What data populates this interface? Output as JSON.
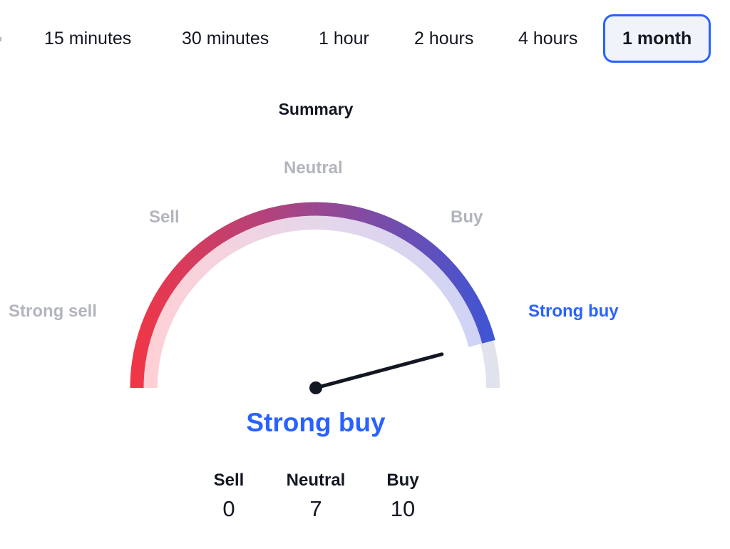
{
  "tabs": [
    {
      "label": "15 minutes",
      "active": false
    },
    {
      "label": "30 minutes",
      "active": false
    },
    {
      "label": "1 hour",
      "active": false
    },
    {
      "label": "2 hours",
      "active": false
    },
    {
      "label": "4 hours",
      "active": false
    },
    {
      "label": "1 month",
      "active": true
    }
  ],
  "summary": {
    "title": "Summary",
    "gauge_labels": {
      "strong_sell": "Strong sell",
      "sell": "Sell",
      "neutral": "Neutral",
      "buy": "Buy",
      "strong_buy": "Strong buy"
    },
    "active_label": "strong_buy",
    "gauge_value": 0.917,
    "result": "Strong buy",
    "counts": [
      {
        "label": "Sell",
        "value": "0"
      },
      {
        "label": "Neutral",
        "value": "7"
      },
      {
        "label": "Buy",
        "value": "10"
      }
    ]
  },
  "colors": {
    "accent": "#2962ff",
    "gauge_start": "#f23645",
    "gauge_mid": "#9b478f",
    "gauge_end": "#3a56d8",
    "muted_label": "#b2b5be",
    "track": "#e0e3eb",
    "text": "#131722"
  }
}
